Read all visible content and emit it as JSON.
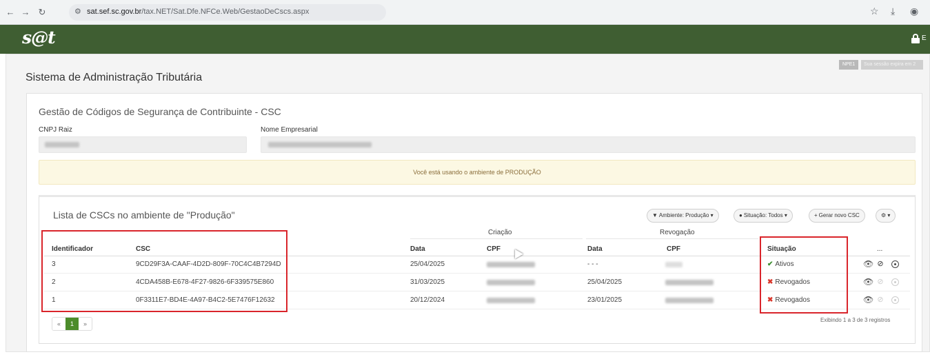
{
  "browser": {
    "url_host": "sat.sef.sc.gov.br",
    "url_path": "/tax.NET/Sat.Dfe.NFCe.Web/GestaoDeCscs.aspx"
  },
  "app": {
    "logo": "s@t",
    "system_title": "Sistema de Administração Tributária",
    "env_badge": "NPE1",
    "session_message": "Sua sessão expira em 2"
  },
  "form": {
    "section_title": "Gestão de Códigos de Segurança de Contribuinte - CSC",
    "cnpj_label": "CNPJ Raiz",
    "company_label": "Nome Empresarial"
  },
  "alert": {
    "text": "Você está usando o ambiente de PRODUÇÃO"
  },
  "list": {
    "title": "Lista de CSCs no ambiente de \"Produção\"",
    "filters": {
      "environment": "Ambiente: Produção",
      "status": "Situação: Todos",
      "generate": "Gerar novo CSC"
    },
    "group_headers": {
      "creation": "Criação",
      "revocation": "Revogação"
    },
    "columns": {
      "id": "Identificador",
      "csc": "CSC",
      "created_date": "Data",
      "created_cpf": "CPF",
      "revoked_date": "Data",
      "revoked_cpf": "CPF",
      "status": "Situação",
      "actions": "..."
    },
    "rows": [
      {
        "id": "3",
        "csc": "9CD29F3A-CAAF-4D2D-809F-70C4C4B7294D",
        "created_date": "25/04/2025",
        "revoked_date": "- - -",
        "status": "Ativos",
        "status_kind": "active"
      },
      {
        "id": "2",
        "csc": "4CDA458B-E678-4F27-9826-6F339575E860",
        "created_date": "31/03/2025",
        "revoked_date": "25/04/2025",
        "status": "Revogados",
        "status_kind": "revoked"
      },
      {
        "id": "1",
        "csc": "0F3311E7-BD4E-4A97-B4C2-5E7476F12632",
        "created_date": "20/12/2024",
        "revoked_date": "23/01/2025",
        "status": "Revogados",
        "status_kind": "revoked"
      }
    ],
    "pagination": {
      "prev": "«",
      "current": "1",
      "next": "»"
    },
    "records_text": "Exibindo 1 a 3 de 3 registros"
  },
  "colors": {
    "header_green": "#3f5e32",
    "active_page": "#4c8c2b",
    "highlight_red": "#d9242a",
    "check_green": "#3c8d2f",
    "x_red": "#d9372b"
  }
}
